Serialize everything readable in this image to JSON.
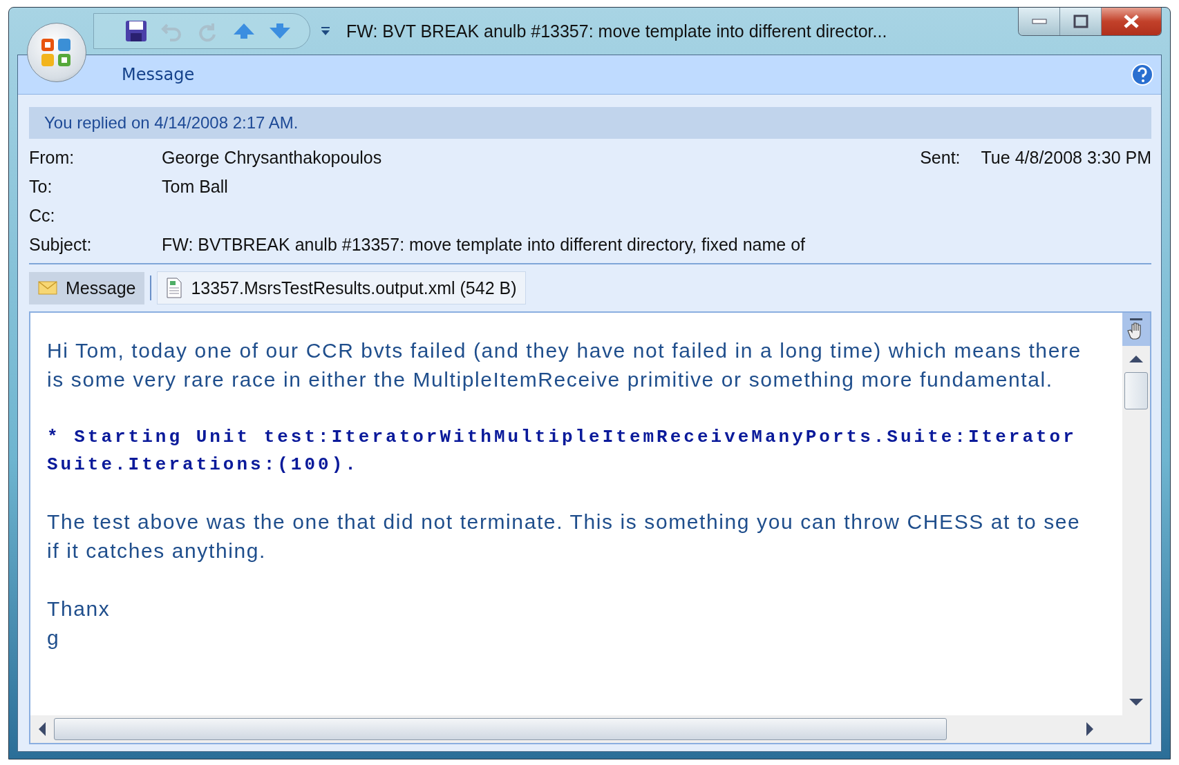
{
  "window": {
    "title": "FW: BVT BREAK anulb #13357: move template into different director..."
  },
  "ribbon_tabs": [
    {
      "label": "Message",
      "selected": true
    }
  ],
  "info_bar": "You replied on 4/14/2008 2:17 AM.",
  "header": {
    "fields": [
      {
        "label": "From:",
        "value": "George Chrysanthakopoulos"
      },
      {
        "label": "To:",
        "value": "Tom Ball"
      },
      {
        "label": "Cc:"
      },
      {
        "label": "Subject:",
        "value": "FW: BVTBREAK anulb #13357: move template into different directory, fixed name of"
      }
    ],
    "sent": {
      "label": "Sent:",
      "value": "Tue 4/8/2008 3:30 PM"
    }
  },
  "attachments": [
    {
      "kind": "message",
      "label": "Message",
      "selected": true
    },
    {
      "kind": "file",
      "label": "13357.MsrsTestResults.output.xml (542 B)",
      "selected": false
    }
  ],
  "body": [
    {
      "kind": "text",
      "lines": [
        "Hi Tom, today one of our CCR bvts failed (and they have not failed in a long time) which means there",
        "is some very rare race in either the MultipleItemReceive primitive or something more fundamental."
      ]
    },
    {
      "kind": "code",
      "lines": [
        "* Starting Unit test:IteratorWithMultipleItemReceiveManyPorts.Suite:Iterator",
        "Suite.Iterations:(100)."
      ]
    },
    {
      "kind": "text",
      "lines": [
        "The test above was the one that did not terminate. This is something you can throw CHESS at to see",
        "if it catches anything."
      ]
    },
    {
      "kind": "text",
      "lines": [
        "Thanx",
        "g"
      ]
    }
  ]
}
